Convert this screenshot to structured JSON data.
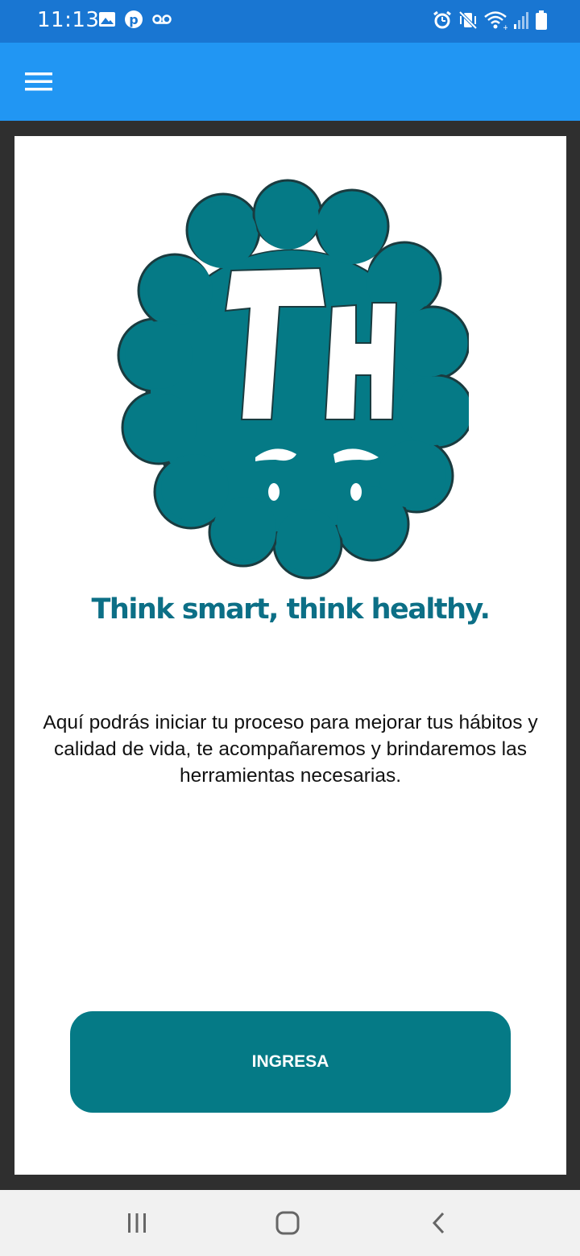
{
  "status_bar": {
    "time": "11:13",
    "left_icons": [
      "image-icon",
      "pinterest-icon",
      "voicemail-icon"
    ],
    "right_icons": [
      "alarm-icon",
      "vibrate-mute-icon",
      "wifi-icon",
      "signal-icon",
      "battery-icon"
    ],
    "color": "#1976d2"
  },
  "toolbar": {
    "menu_icon": "hamburger-menu-icon",
    "color": "#2196f3"
  },
  "logo": {
    "text": "TH",
    "color": "#057a86"
  },
  "tagline": "Think smart, think healthy.",
  "description": "Aquí podrás iniciar tu proceso para mejorar tus hábitos y calidad de vida, te acompañaremos y brindaremos las herramientas necesarias.",
  "primary_button": {
    "label": "INGRESA",
    "color": "#057a86"
  },
  "nav_bar": {
    "icons": [
      "recent-apps-icon",
      "home-icon",
      "back-icon"
    ]
  }
}
